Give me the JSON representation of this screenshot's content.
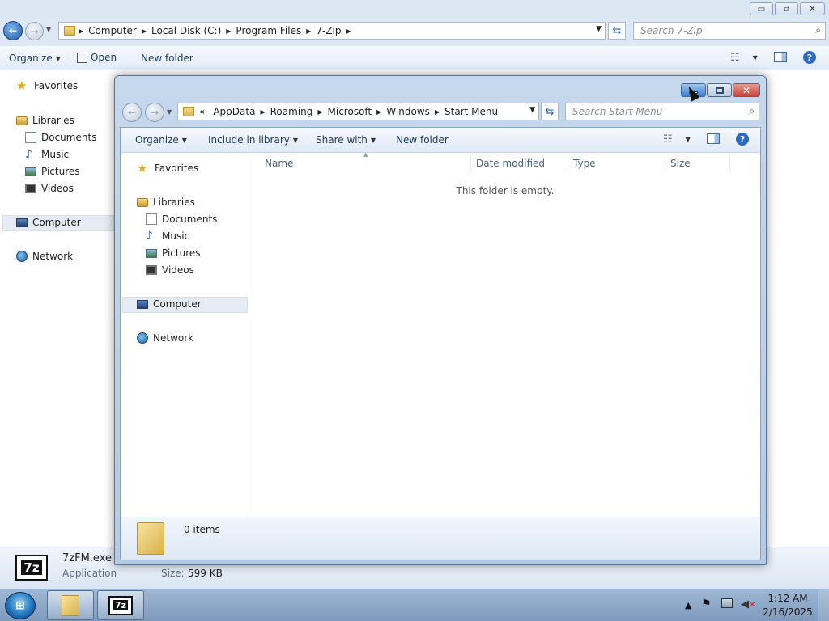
{
  "background_window": {
    "caption_buttons": [
      "▭",
      "⧉",
      "✕"
    ],
    "address": [
      "Computer",
      "Local Disk (C:)",
      "Program Files",
      "7-Zip"
    ],
    "search_placeholder": "Search 7-Zip",
    "toolbar": {
      "organize": "Organize",
      "open": "Open",
      "new_folder": "New folder"
    },
    "nav": {
      "favorites": "Favorites",
      "libraries": "Libraries",
      "documents": "Documents",
      "music": "Music",
      "pictures": "Pictures",
      "videos": "Videos",
      "computer": "Computer",
      "network": "Network"
    },
    "status": {
      "icon_label": "7z",
      "file_name": "7zFM.exe",
      "file_type": "Application",
      "size_label": "Size:",
      "size_value": "599 KB"
    }
  },
  "foreground_window": {
    "address_prefix": "«",
    "address": [
      "AppData",
      "Roaming",
      "Microsoft",
      "Windows",
      "Start Menu"
    ],
    "search_placeholder": "Search Start Menu",
    "toolbar": {
      "organize": "Organize",
      "include_in_library": "Include in library",
      "share_with": "Share with",
      "new_folder": "New folder"
    },
    "nav": {
      "favorites": "Favorites",
      "libraries": "Libraries",
      "documents": "Documents",
      "music": "Music",
      "pictures": "Pictures",
      "videos": "Videos",
      "computer": "Computer",
      "network": "Network"
    },
    "columns": {
      "name": "Name",
      "date_modified": "Date modified",
      "type": "Type",
      "size": "Size"
    },
    "empty_message": "This folder is empty.",
    "item_count": "0 items"
  },
  "taskbar": {
    "app_7zip_label": "7z",
    "time": "1:12 AM",
    "date": "2/16/2025",
    "tray_icons": [
      "chevron-up-icon",
      "flag-icon",
      "network-icon",
      "volume-muted-icon"
    ]
  },
  "colors": {
    "accent_blue": "#2b62b5",
    "close_red": "#c9443a",
    "minimize_hover": "#4f8fd6"
  }
}
